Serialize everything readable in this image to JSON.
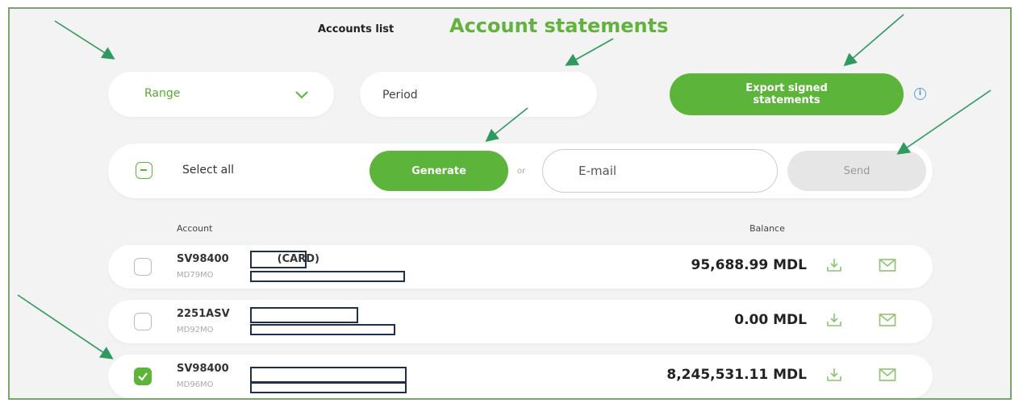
{
  "header": {
    "accounts_list": "Accounts list",
    "title": "Account statements"
  },
  "filters": {
    "range_label": "Range",
    "period_placeholder": "Period",
    "export_label": "Export signed statements"
  },
  "action_bar": {
    "select_all": "Select all",
    "generate": "Generate",
    "or": "or",
    "email_placeholder": "E-mail",
    "send": "Send"
  },
  "table": {
    "col_account": "Account",
    "col_balance": "Balance",
    "rows": [
      {
        "name_prefix": "SV98400",
        "name_suffix": "(CARD)",
        "iban_prefix": "MD79MO",
        "balance": "95,688.99 MDL",
        "checked": false
      },
      {
        "name_prefix": "2251ASV",
        "name_suffix": "",
        "iban_prefix": "MD92MO",
        "balance": "0.00 MDL",
        "checked": false
      },
      {
        "name_prefix": "SV98400",
        "name_suffix": "",
        "iban_prefix": "MD96MO",
        "balance": "8,245,531.11 MDL",
        "checked": true
      }
    ]
  },
  "colors": {
    "brand_green": "#5cb53a",
    "title_green": "#62b23f",
    "annotation_arrow": "#2e9a5e",
    "redaction_border": "#1f2f4a"
  }
}
